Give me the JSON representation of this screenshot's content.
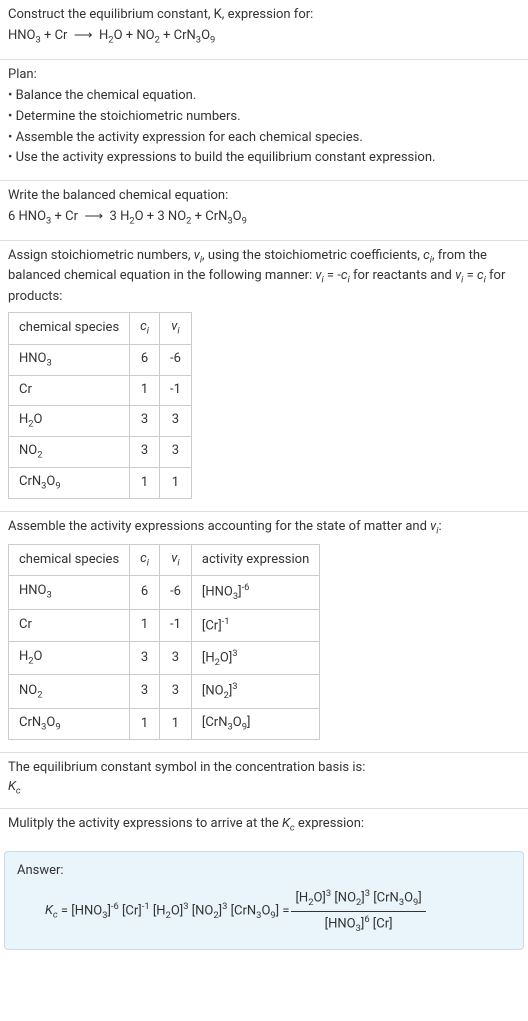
{
  "intro": {
    "line1": "Construct the equilibrium constant, K, expression for:",
    "eq_left": "HNO₃ + Cr",
    "arrow": "⟶",
    "eq_right": "H₂O + NO₂ + CrN₃O₉"
  },
  "plan": {
    "title": "Plan:",
    "items": [
      "• Balance the chemical equation.",
      "• Determine the stoichiometric numbers.",
      "• Assemble the activity expression for each chemical species.",
      "• Use the activity expressions to build the equilibrium constant expression."
    ]
  },
  "balanced": {
    "title": "Write the balanced chemical equation:",
    "eq_left": "6 HNO₃ + Cr",
    "arrow": "⟶",
    "eq_right": "3 H₂O + 3 NO₂ + CrN₃O₉"
  },
  "stoich_assign": {
    "text": "Assign stoichiometric numbers, νᵢ, using the stoichiometric coefficients, cᵢ, from the balanced chemical equation in the following manner: νᵢ = -cᵢ for reactants and νᵢ = cᵢ for products:",
    "headers": [
      "chemical species",
      "cᵢ",
      "νᵢ"
    ],
    "rows": [
      {
        "sp": "HNO₃",
        "c": "6",
        "v": "-6"
      },
      {
        "sp": "Cr",
        "c": "1",
        "v": "-1"
      },
      {
        "sp": "H₂O",
        "c": "3",
        "v": "3"
      },
      {
        "sp": "NO₂",
        "c": "3",
        "v": "3"
      },
      {
        "sp": "CrN₃O₉",
        "c": "1",
        "v": "1"
      }
    ]
  },
  "activity": {
    "title": "Assemble the activity expressions accounting for the state of matter and νᵢ:",
    "headers": [
      "chemical species",
      "cᵢ",
      "νᵢ",
      "activity expression"
    ],
    "rows": [
      {
        "sp": "HNO₃",
        "c": "6",
        "v": "-6",
        "ae_base": "[HNO₃]",
        "ae_exp": "-6"
      },
      {
        "sp": "Cr",
        "c": "1",
        "v": "-1",
        "ae_base": "[Cr]",
        "ae_exp": "-1"
      },
      {
        "sp": "H₂O",
        "c": "3",
        "v": "3",
        "ae_base": "[H₂O]",
        "ae_exp": "3"
      },
      {
        "sp": "NO₂",
        "c": "3",
        "v": "3",
        "ae_base": "[NO₂]",
        "ae_exp": "3"
      },
      {
        "sp": "CrN₃O₉",
        "c": "1",
        "v": "1",
        "ae_base": "[CrN₃O₉]",
        "ae_exp": ""
      }
    ]
  },
  "kc_symbol": {
    "line1": "The equilibrium constant symbol in the concentration basis is:",
    "symbol": "K_c"
  },
  "multiply": {
    "title": "Mulitply the activity expressions to arrive at the K_c expression:"
  },
  "answer": {
    "label": "Answer:",
    "kc": "K_c = ",
    "prod": "[HNO₃]⁻⁶ [Cr]⁻¹ [H₂O]³ [NO₂]³ [CrN₃O₉] = ",
    "frac_num": "[H₂O]³ [NO₂]³ [CrN₃O₉]",
    "frac_den": "[HNO₃]⁶ [Cr]"
  }
}
